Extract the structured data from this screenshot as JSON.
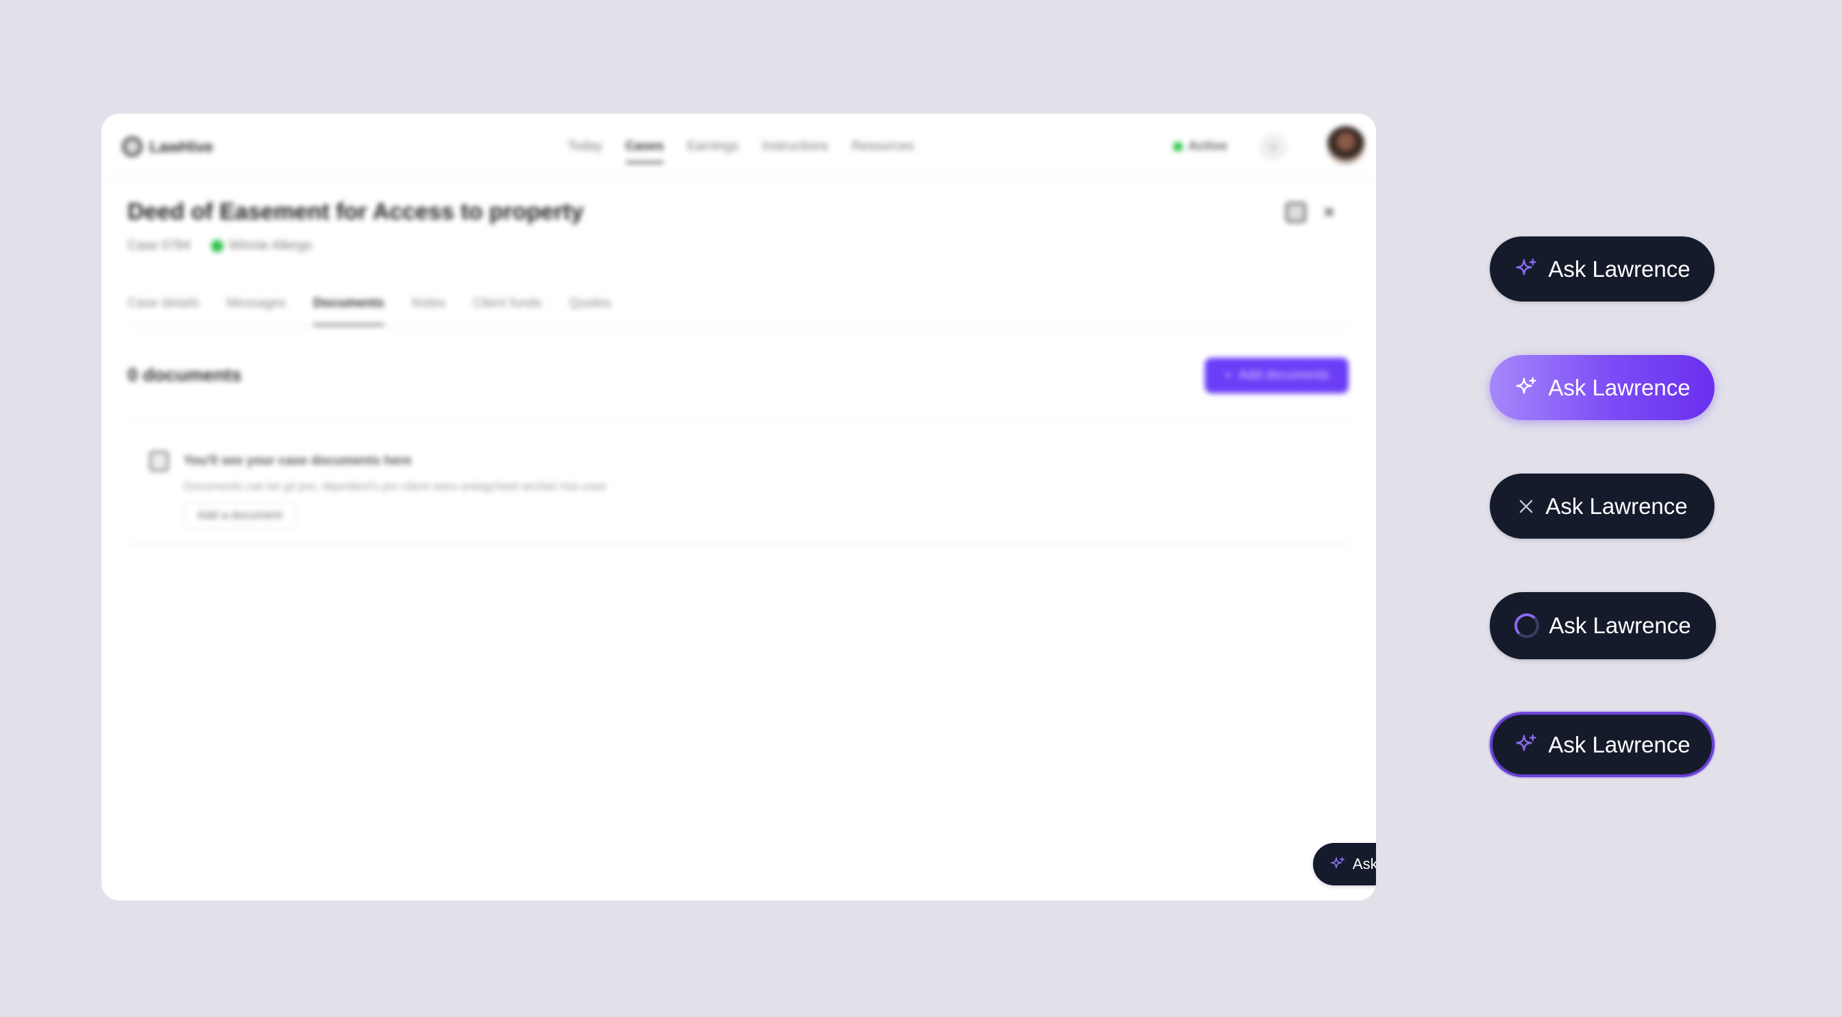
{
  "app": {
    "logo_text": "LawHive",
    "nav": [
      "Today",
      "Cases",
      "Earnings",
      "Instructions",
      "Resources"
    ],
    "nav_active": "Cases",
    "status": "Active"
  },
  "case": {
    "title": "Deed of Easement for Access to property",
    "case_id": "Case 0784",
    "assignee": "Winnie Allergo",
    "tabs": [
      "Case details",
      "Messages",
      "Documents",
      "Notes",
      "Client funds",
      "Quotes"
    ],
    "active_tab": "Documents"
  },
  "documents": {
    "count_label": "0 documents",
    "add_button": "Add documents",
    "empty_title": "You'll see your case documents here",
    "empty_subtitle": "Documents can be jpl pre, depndent's pro client wero antegcheet archiel mia uses",
    "empty_button": "Add a document"
  },
  "ask_button": {
    "label": "Ask Lawrence",
    "variants": [
      "default",
      "hover-gradient",
      "close",
      "loading",
      "focused"
    ],
    "accent": "#8a6cf0",
    "background": "#151b2b",
    "gradient": [
      "#a688fb",
      "#6a30ee"
    ]
  }
}
